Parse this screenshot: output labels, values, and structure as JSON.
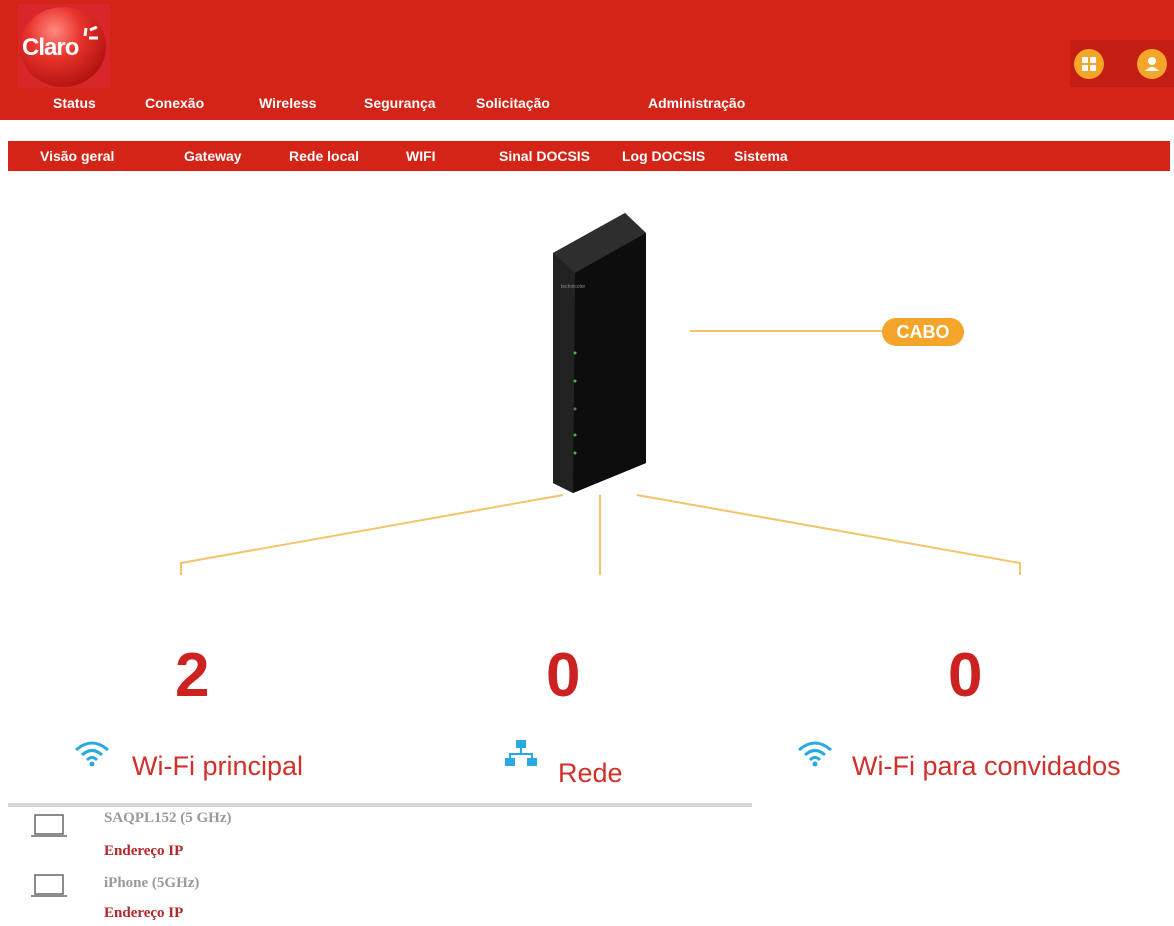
{
  "header": {
    "logo_text": "Claro",
    "nav": [
      "Status",
      "Conexão",
      "Wireless",
      "Segurança",
      "Solicitação",
      "Administração"
    ]
  },
  "subnav": [
    "Visão geral",
    "Gateway",
    "Rede local",
    "WIFI",
    "Sinal DOCSIS",
    "Log DOCSIS",
    "Sistema"
  ],
  "router": {
    "brand": "technicolor"
  },
  "connection": {
    "cabo_label": "CABO"
  },
  "stats": [
    {
      "count": "2",
      "label": "Wi-Fi principal",
      "icon": "wifi-icon"
    },
    {
      "count": "0",
      "label": "Rede",
      "icon": "network-icon"
    },
    {
      "count": "0",
      "label": "Wi-Fi para convidados",
      "icon": "wifi-icon"
    }
  ],
  "devices": [
    {
      "name": "SAQPL152 (5 GHz)",
      "ip_label": "Endereço IP",
      "icon": "laptop-icon"
    },
    {
      "name": "iPhone (5GHz)",
      "ip_label": "Endereço IP",
      "icon": "laptop-icon"
    }
  ],
  "colors": {
    "brand_red": "#d42317",
    "accent_orange": "#f5a52a",
    "count_red": "#cc2222",
    "wifi_blue": "#29a9e1"
  }
}
